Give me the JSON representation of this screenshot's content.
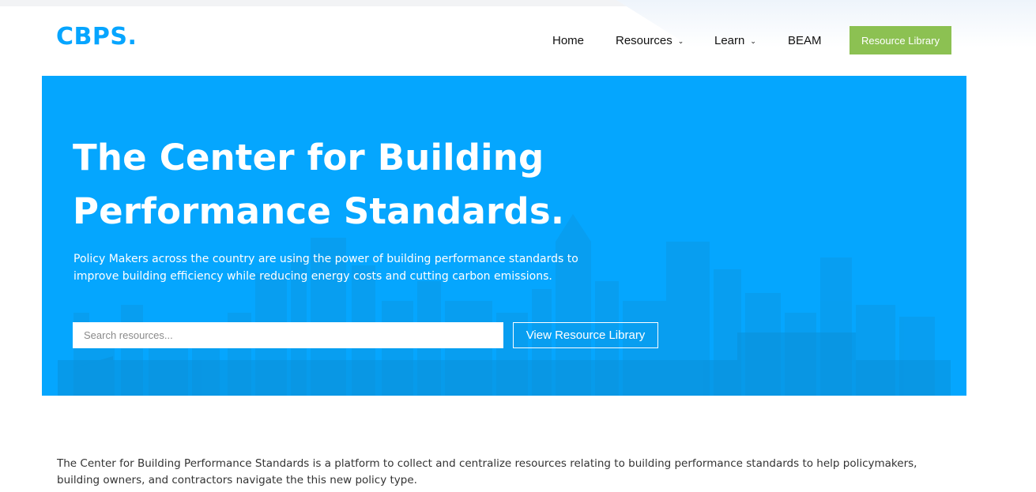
{
  "header": {
    "logo": "CBPS.",
    "nav": [
      {
        "label": "Home",
        "has_dropdown": false
      },
      {
        "label": "Resources",
        "has_dropdown": true
      },
      {
        "label": "Learn",
        "has_dropdown": true
      },
      {
        "label": "BEAM",
        "has_dropdown": false
      }
    ],
    "cta_label": "Resource Library"
  },
  "hero": {
    "title_line1": "The Center for Building",
    "title_line2": "Performance Standards.",
    "subtitle_line1": "Policy Makers across the country are using the power of building performance standards to",
    "subtitle_line2": "improve building efficiency while reducing energy costs and cutting carbon emissions.",
    "search_placeholder": "Search resources...",
    "search_value": "",
    "button_label": "View Resource Library"
  },
  "intro": {
    "text_line1": "The Center for Building Performance Standards is a platform to collect and centralize resources relating to building performance standards to help policymakers,",
    "text_line2": "building owners, and contractors navigate the this new policy type."
  },
  "colors": {
    "brand_blue": "#06a5ff",
    "hero_blue": "#05a6fe",
    "cta_green": "#8cc152",
    "text_dark": "#111111"
  },
  "icons": {
    "dropdown": "chevron-down-icon"
  }
}
